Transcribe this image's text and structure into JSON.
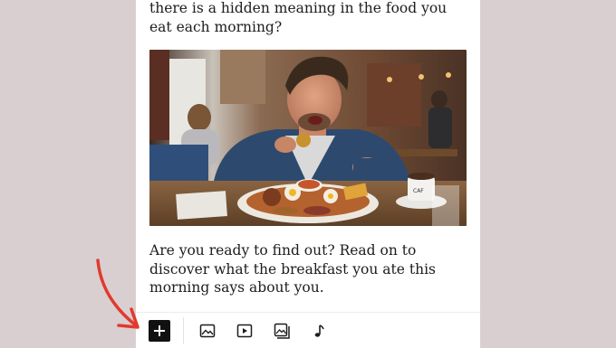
{
  "article": {
    "paragraph_top": "there is a hidden meaning in the food you eat each morning?",
    "paragraph_bottom": "Are you ready to find out? Read on to discover what the breakfast you ate this morning says about you.",
    "image_cup_text": "CAF"
  },
  "toolbar": {
    "buttons": [
      {
        "name": "add-block-button",
        "icon": "plus-icon"
      },
      {
        "name": "image-block-button",
        "icon": "image-icon"
      },
      {
        "name": "video-block-button",
        "icon": "play-icon"
      },
      {
        "name": "gallery-block-button",
        "icon": "gallery-icon"
      },
      {
        "name": "audio-block-button",
        "icon": "music-note-icon"
      }
    ]
  },
  "colors": {
    "page_background": "#d9cfd0",
    "card_background": "#ffffff",
    "annotation_arrow": "#e03a2e",
    "add_button": "#111111"
  }
}
